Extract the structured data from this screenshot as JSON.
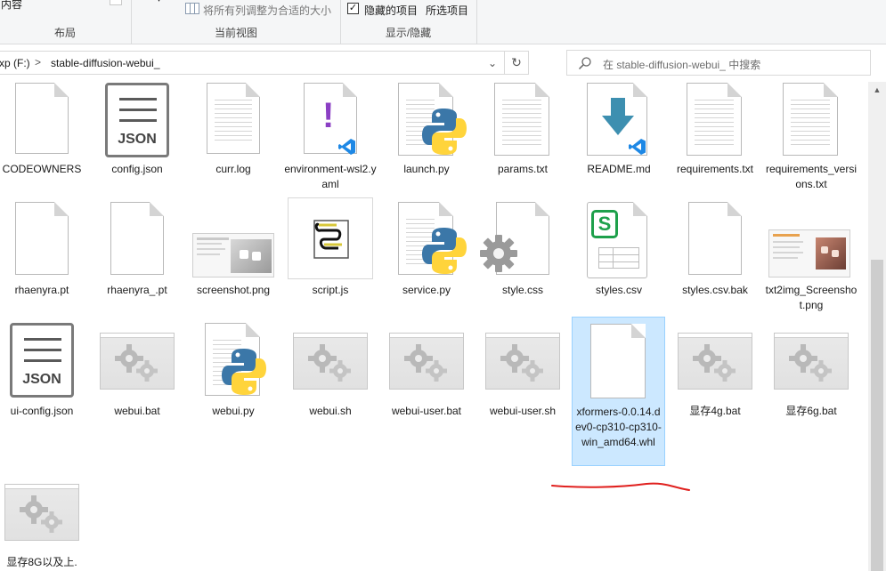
{
  "ribbon": {
    "layout_partial_label": "内容",
    "layout_group": "布局",
    "autofit_label": "将所有列调整为合适的大小",
    "current_view_group": "当前视图",
    "hidden_items_label": "隐藏的项目",
    "hidden_items_checked": true,
    "hide_selected_label": "所选项目",
    "show_hide_group": "显示/隐藏"
  },
  "address": {
    "drive": "xp (F:)",
    "separator": ">",
    "folder": "stable-diffusion-webui_"
  },
  "search": {
    "placeholder": "在 stable-diffusion-webui_ 中搜索"
  },
  "files": [
    {
      "name": "CODEOWNERS",
      "icon": "blank-file-icon"
    },
    {
      "name": "config.json",
      "icon": "json-file-icon"
    },
    {
      "name": "curr.log",
      "icon": "text-file-icon"
    },
    {
      "name": "environment-wsl2.yaml",
      "icon": "vscode-yaml-icon"
    },
    {
      "name": "launch.py",
      "icon": "python-file-icon"
    },
    {
      "name": "params.txt",
      "icon": "text-file-icon"
    },
    {
      "name": "README.md",
      "icon": "vscode-markdown-icon"
    },
    {
      "name": "requirements.txt",
      "icon": "text-file-icon"
    },
    {
      "name": "requirements_versions.txt",
      "icon": "text-file-icon"
    },
    {
      "name": "rhaenyra.pt",
      "icon": "blank-file-icon"
    },
    {
      "name": "rhaenyra_.pt",
      "icon": "blank-file-icon"
    },
    {
      "name": "screenshot.png",
      "icon": "image-thumbnail-icon"
    },
    {
      "name": "script.js",
      "icon": "script-file-icon"
    },
    {
      "name": "service.py",
      "icon": "python-file-icon"
    },
    {
      "name": "style.css",
      "icon": "css-gear-file-icon"
    },
    {
      "name": "styles.csv",
      "icon": "spreadsheet-file-icon"
    },
    {
      "name": "styles.csv.bak",
      "icon": "blank-file-icon"
    },
    {
      "name": "txt2img_Screenshot.png",
      "icon": "image-thumbnail-icon"
    },
    {
      "name": "ui-config.json",
      "icon": "json-file-icon"
    },
    {
      "name": "webui.bat",
      "icon": "batch-gear-icon"
    },
    {
      "name": "webui.py",
      "icon": "python-file-icon"
    },
    {
      "name": "webui.sh",
      "icon": "batch-gear-icon"
    },
    {
      "name": "webui-user.bat",
      "icon": "batch-gear-icon"
    },
    {
      "name": "webui-user.sh",
      "icon": "batch-gear-icon"
    },
    {
      "name": "xformers-0.0.14.dev0-cp310-cp310-win_amd64.whl",
      "icon": "blank-file-icon",
      "selected": true
    },
    {
      "name": "显存4g.bat",
      "icon": "batch-gear-icon"
    },
    {
      "name": "显存6g.bat",
      "icon": "batch-gear-icon"
    },
    {
      "name": "显存8G以及上.",
      "icon": "batch-gear-icon"
    }
  ],
  "json_icon_text": "JSON",
  "colors": {
    "selection": "#cce8ff",
    "annotation": "#e0201e",
    "python_blue": "#3b77a8",
    "python_yellow": "#ffd43b",
    "vscode_blue": "#1e88e5"
  }
}
